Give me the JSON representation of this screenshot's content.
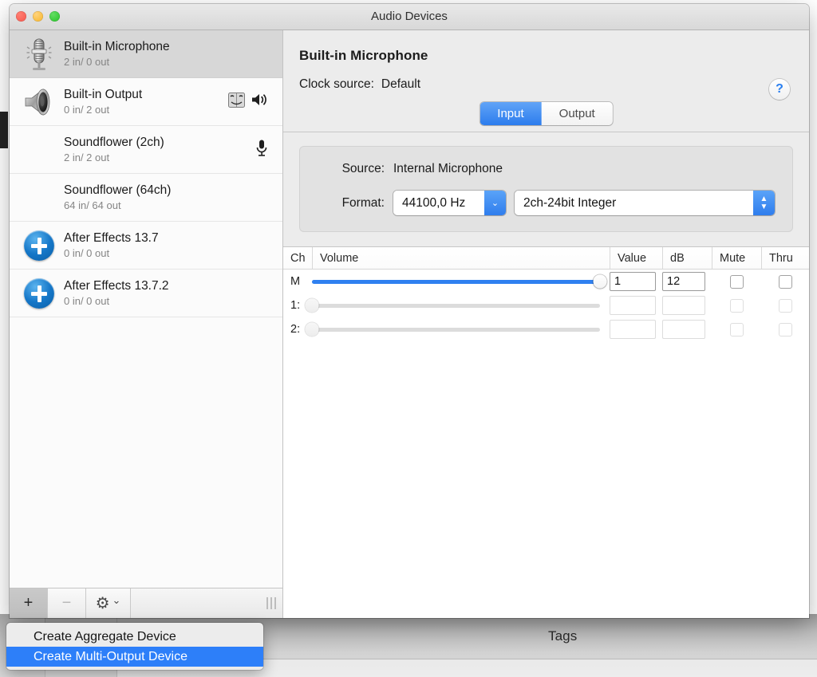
{
  "window": {
    "title": "Audio Devices"
  },
  "background": {
    "tags_label": "Tags"
  },
  "devices": [
    {
      "name": "Built-in Microphone",
      "io": "2 in/ 0 out",
      "icon": "microphone-icon",
      "selected": true,
      "badges": []
    },
    {
      "name": "Built-in Output",
      "io": "0 in/ 2 out",
      "icon": "speaker-icon",
      "selected": false,
      "badges": [
        "finder-face-icon",
        "sound-output-icon"
      ]
    },
    {
      "name": "Soundflower (2ch)",
      "io": "2 in/ 2 out",
      "icon": "none",
      "selected": false,
      "badges": [
        "sound-input-icon"
      ]
    },
    {
      "name": "Soundflower (64ch)",
      "io": "64 in/ 64 out",
      "icon": "none",
      "selected": false,
      "badges": []
    },
    {
      "name": "After Effects 13.7",
      "io": "0 in/ 0 out",
      "icon": "plus-circle-icon",
      "selected": false,
      "badges": []
    },
    {
      "name": "After Effects 13.7.2",
      "io": "0 in/ 0 out",
      "icon": "plus-circle-icon",
      "selected": false,
      "badges": []
    }
  ],
  "toolbar": {
    "add_label": "+",
    "remove_label": "−",
    "gear_label": "⚙",
    "gear_chevron": "⌄"
  },
  "pane": {
    "title": "Built-in Microphone",
    "clock_label": "Clock source:",
    "clock_value": "Default",
    "help_label": "?",
    "tabs": [
      {
        "label": "Input",
        "active": true
      },
      {
        "label": "Output",
        "active": false
      }
    ],
    "source_label": "Source:",
    "source_value": "Internal Microphone",
    "format_label": "Format:",
    "sample_rate": "44100,0 Hz",
    "bit_format": "2ch-24bit Integer",
    "rate_chevron": "⌄",
    "stepper_up": "▲",
    "stepper_down": "▼"
  },
  "channel_table": {
    "headers": [
      "Ch",
      "Volume",
      "Value",
      "dB",
      "Mute",
      "Thru"
    ],
    "rows": [
      {
        "ch": "M",
        "volume_pct": 100,
        "value": "1",
        "db": "12",
        "mute": false,
        "thru": false,
        "enabled": true
      },
      {
        "ch": "1:",
        "volume_pct": 0,
        "value": "",
        "db": "",
        "mute": false,
        "thru": false,
        "enabled": false
      },
      {
        "ch": "2:",
        "volume_pct": 0,
        "value": "",
        "db": "",
        "mute": false,
        "thru": false,
        "enabled": false
      }
    ]
  },
  "context_menu": {
    "items": [
      {
        "label": "Create Aggregate Device",
        "highlighted": false
      },
      {
        "label": "Create Multi-Output Device",
        "highlighted": true
      }
    ]
  },
  "colors": {
    "accent_blue": "#2d7ff9",
    "slider_blue": "#2f80f0",
    "selected_row": "#d7d7d7",
    "help_blue": "#2a7ff0"
  }
}
